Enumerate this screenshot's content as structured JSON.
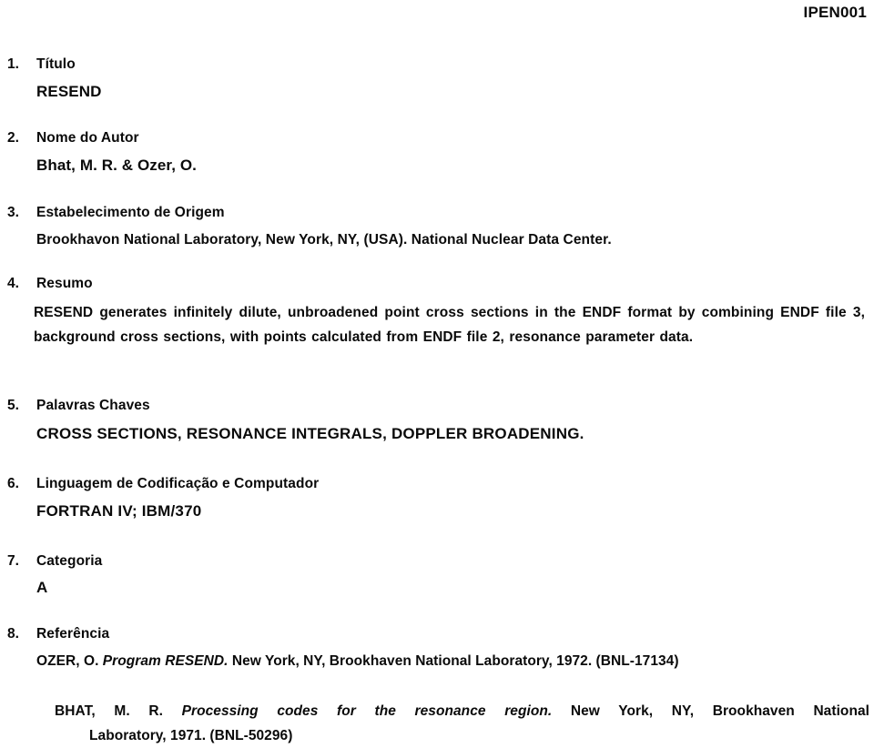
{
  "document": {
    "id": "IPEN001"
  },
  "sections": [
    {
      "number": "1.",
      "label": "Título",
      "value": "RESEND"
    },
    {
      "number": "2.",
      "label": "Nome do Autor",
      "value": "Bhat, M. R. & Ozer, O."
    },
    {
      "number": "3.",
      "label": "Estabelecimento de Origem",
      "value": "Brookhavon National Laboratory, New York, NY, (USA). National Nuclear Data Center."
    },
    {
      "number": "4.",
      "label": "Resumo",
      "value": "RESEND generates infinitely dilute, unbroadened point cross sections in the ENDF format by combining ENDF file 3, background cross sections, with points calculated from ENDF file 2, resonance parameter data."
    },
    {
      "number": "5.",
      "label": "Palavras Chaves",
      "value": "CROSS SECTIONS, RESONANCE INTEGRALS, DOPPLER BROADENING."
    },
    {
      "number": "6.",
      "label": "Linguagem de Codificação e Computador",
      "value": "FORTRAN IV; IBM/370"
    },
    {
      "number": "7.",
      "label": "Categoria",
      "value": "A"
    },
    {
      "number": "8.",
      "label": "Referência",
      "value": ""
    }
  ],
  "references": [
    {
      "author": "OZER, O.",
      "title": "Program RESEND.",
      "rest": "New York, NY, Brookhaven National Laboratory, 1972. (BNL-17134)"
    },
    {
      "author": "BHAT, M. R.",
      "title": "Processing codes for the resonance region.",
      "rest_line1": "New York, NY, Brookhaven National",
      "rest_line2": "Laboratory, 1971. (BNL-50296)"
    }
  ]
}
